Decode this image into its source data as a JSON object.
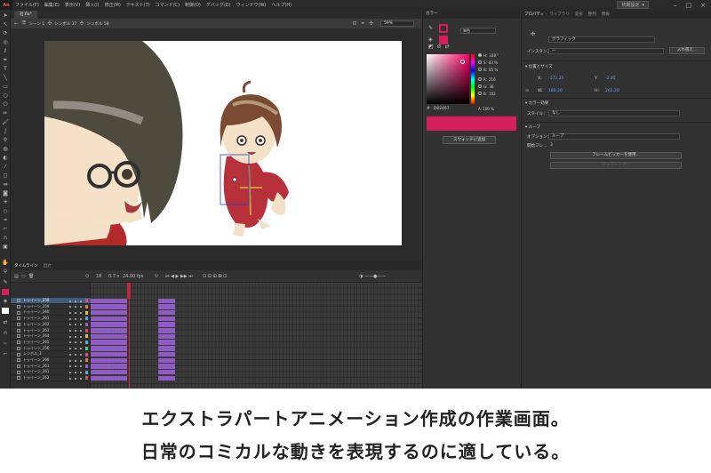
{
  "app": {
    "logo": "An",
    "menu": [
      "ファイル(F)",
      "編集(E)",
      "表示(V)",
      "挿入(I)",
      "修正(M)",
      "テキスト(T)",
      "コマンド(C)",
      "制御(O)",
      "デバッグ(D)",
      "ウィンドウ(W)",
      "ヘルプ(H)"
    ],
    "workspace": "初期設定"
  },
  "document": {
    "tab": "社.fla*",
    "breadcrumb": [
      "シーン 1",
      "シンボル 37",
      "シンボル 58"
    ],
    "zoom": "59%"
  },
  "color_panel": {
    "tab": "カラー",
    "fill_type": "単色",
    "hsb": [
      {
        "label": "H:",
        "value": "338 °"
      },
      {
        "label": "S:",
        "value": "83 %"
      },
      {
        "label": "B:",
        "value": "85 %"
      },
      {
        "label": "R:",
        "value": "216"
      },
      {
        "label": "G:",
        "value": "36"
      },
      {
        "label": "B:",
        "value": "102"
      }
    ],
    "hex": "D82467",
    "alpha": "A: 100 %",
    "add_swatch": "スウォッチに追加",
    "color": "#d81f5e"
  },
  "properties": {
    "tabs": [
      "プロパティ",
      "ライブラリ",
      "変形",
      "整列",
      "情報"
    ],
    "symbol_type": "グラフィック",
    "instance_label": "インスタンス：",
    "instance_value": "一",
    "swap": "入れ替え...",
    "position_size": "位置とサイズ",
    "x_label": "X:",
    "x_value": "-172.25",
    "y_label": "Y:",
    "y_value": "-2.95",
    "w_label": "W:",
    "w_value": "180.20",
    "h_label": "H:",
    "h_value": "261.20",
    "color_effect": "カラー効果",
    "style_label": "スタイル：",
    "style_value": "なし",
    "loop": "ループ",
    "options_label": "オプション：",
    "options_value": "ループ",
    "first_frame_label": "開始フレ...",
    "first_frame_value": "3",
    "frame_picker": "フレームピッカーを使用...",
    "lip_sync": "リップシンク..."
  },
  "timeline": {
    "tabs": [
      "タイムライン",
      "出力"
    ],
    "fps": "24.00 fps",
    "frame": "18",
    "time": "0.7 s",
    "ruler_numbers": [
      "1",
      "5",
      "10",
      "15",
      "20",
      "25",
      "30",
      "35",
      "40",
      "45",
      "50",
      "55",
      "60",
      "65",
      "70",
      "75",
      "80",
      "85",
      "90",
      "95",
      "100",
      "105"
    ],
    "ruler_labels": [
      "1s",
      "2s",
      "3s",
      "4s"
    ],
    "layers": [
      {
        "name": "トゥイーン_258",
        "color": "#e64b8a",
        "selected": true
      },
      {
        "name": "トゥイーン_259",
        "color": "#d8823a",
        "selected": false
      },
      {
        "name": "トゥイーン_260",
        "color": "#e0c23a",
        "selected": false
      },
      {
        "name": "トゥイーン_261",
        "color": "#46b0e0",
        "selected": false
      },
      {
        "name": "トゥイーン_262",
        "color": "#9a5cd0",
        "selected": false
      },
      {
        "name": "トゥイーン_263",
        "color": "#e64b4b",
        "selected": false
      },
      {
        "name": "トゥイーン_264",
        "color": "#e0c23a",
        "selected": false
      },
      {
        "name": "トゥイーン_265",
        "color": "#46b0e0",
        "selected": false
      },
      {
        "name": "トゥイーン_256",
        "color": "#4bd080",
        "selected": false
      },
      {
        "name": "シンボル_3",
        "color": "#e64b8a",
        "selected": false
      },
      {
        "name": "トゥイーン_266",
        "color": "#d8823a",
        "selected": false
      },
      {
        "name": "トゥイーン_261",
        "color": "#9a5cd0",
        "selected": false
      },
      {
        "name": "トゥイーン_261",
        "color": "#46b0e0",
        "selected": false
      },
      {
        "name": "トゥイーン_262",
        "color": "#e64b4b",
        "selected": false
      }
    ]
  },
  "caption": {
    "line1": "エクストラパートアニメーション作成の作業画面。",
    "line2": "日常のコミカルな動きを表現するのに適している。"
  }
}
